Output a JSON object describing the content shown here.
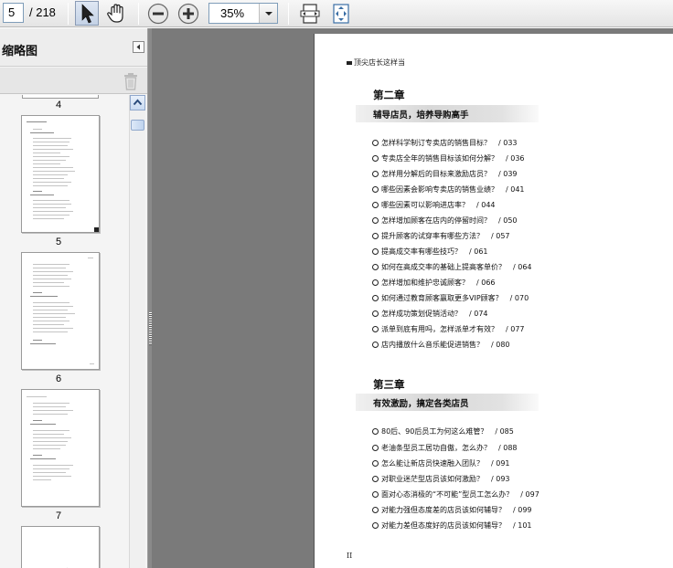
{
  "toolbar": {
    "current_page": "5",
    "total_pages": "/ 218",
    "zoom": "35%",
    "icons": [
      "select-arrow-icon",
      "hand-icon",
      "zoom-out-icon",
      "zoom-in-icon",
      "chevron-down-icon",
      "fit-width-icon",
      "fit-page-icon"
    ]
  },
  "sidebar": {
    "title": "缩略图",
    "thumbnails": [
      {
        "label": "4"
      },
      {
        "label": "5",
        "selected": true
      },
      {
        "label": "6"
      },
      {
        "label": "7"
      }
    ]
  },
  "document": {
    "running_head": "顶尖店长这样当",
    "folio": "II",
    "chapters": [
      {
        "title": "第二章",
        "subtitle": "辅导店员，培养导购高手",
        "entries": [
          "怎样科学制订专卖店的销售目标？　/ 033",
          "专卖店全年的销售目标该如何分解？　/ 036",
          "怎样用分解后的目标来激励店员？　/ 039",
          "哪些因素会影响专卖店的销售业绩？　/ 041",
          "哪些因素可以影响进店率？　/ 044",
          "怎样增加顾客在店内的停留时间？　/ 050",
          "提升顾客的试穿率有哪些方法？　/ 057",
          "提高成交率有哪些技巧？　/ 061",
          "如何在高成交率的基础上提高客单价？　/ 064",
          "怎样增加和维护忠诚顾客？　/ 066",
          "如何通过教育顾客赢取更多VIP顾客？　/ 070",
          "怎样成功策划促销活动？　/ 074",
          "派单到底有用吗，怎样派单才有效？　/ 077",
          "店内播放什么音乐能促进销售？　/ 080"
        ]
      },
      {
        "title": "第三章",
        "subtitle": "有效激励，搞定各类店员",
        "entries": [
          "80后、90后员工为何这么难管？　/ 085",
          "老油条型员工居功自傲，怎么办？　/ 088",
          "怎么能让新店员快速融入团队？　/ 091",
          "对职业迷茫型店员该如何激励？　/ 093",
          "面对心态消极的“不可能”型员工怎么办？　/ 097",
          "对能力强但态度差的店员该如何辅导？　/ 099",
          "对能力差但态度好的店员该如何辅导？　/ 101"
        ]
      }
    ]
  }
}
